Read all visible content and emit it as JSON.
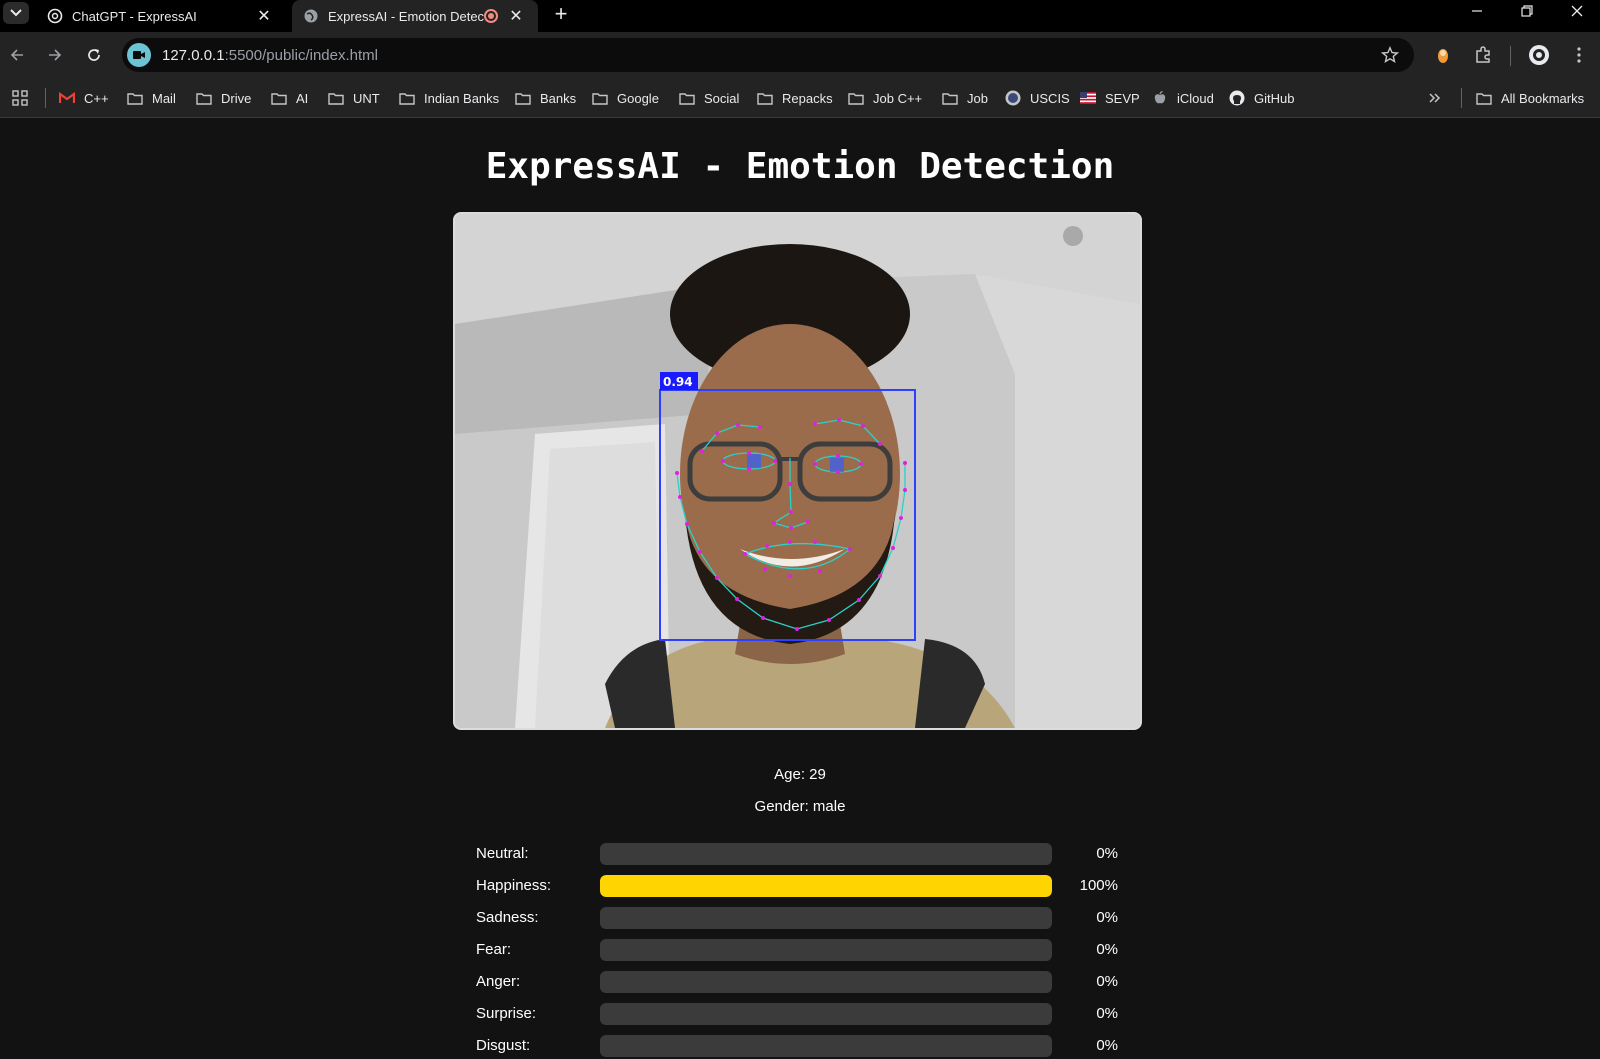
{
  "browser": {
    "tabs": [
      {
        "title": "ChatGPT - ExpressAI",
        "active": false
      },
      {
        "title": "ExpressAI - Emotion Detecti",
        "active": true
      }
    ],
    "url_host": "127.0.0.1",
    "url_rest": ":5500/public/index.html",
    "bookmarks": [
      {
        "label": "C++",
        "icon": "gmail-icon"
      },
      {
        "label": "Mail",
        "icon": "folder-icon"
      },
      {
        "label": "Drive",
        "icon": "folder-icon"
      },
      {
        "label": "AI",
        "icon": "folder-icon"
      },
      {
        "label": "UNT",
        "icon": "folder-icon"
      },
      {
        "label": "Indian Banks",
        "icon": "folder-icon"
      },
      {
        "label": "Banks",
        "icon": "folder-icon"
      },
      {
        "label": "Google",
        "icon": "folder-icon"
      },
      {
        "label": "Social",
        "icon": "folder-icon"
      },
      {
        "label": "Repacks",
        "icon": "folder-icon"
      },
      {
        "label": "Job C++",
        "icon": "folder-icon"
      },
      {
        "label": "Job",
        "icon": "folder-icon"
      },
      {
        "label": "USCIS",
        "icon": "uscis-seal-icon"
      },
      {
        "label": "SEVP",
        "icon": "us-flag-icon"
      },
      {
        "label": "iCloud",
        "icon": "apple-icon"
      },
      {
        "label": "GitHub",
        "icon": "github-icon"
      }
    ],
    "all_bookmarks_label": "All Bookmarks"
  },
  "page": {
    "title": "ExpressAI - Emotion Detection",
    "detection_score": "0.94",
    "age_text": "Age: 29",
    "gender_text": "Gender: male"
  },
  "emotions": [
    {
      "label": "Neutral:",
      "percent_text": "0%",
      "value": 0
    },
    {
      "label": "Happiness:",
      "percent_text": "100%",
      "value": 1.0
    },
    {
      "label": "Sadness:",
      "percent_text": "0%",
      "value": 0
    },
    {
      "label": "Fear:",
      "percent_text": "0%",
      "value": 0
    },
    {
      "label": "Anger:",
      "percent_text": "0%",
      "value": 0
    },
    {
      "label": "Surprise:",
      "percent_text": "0%",
      "value": 0
    },
    {
      "label": "Disgust:",
      "percent_text": "0%",
      "value": 0
    }
  ],
  "colors": {
    "bar_fill": "#ffd400",
    "bar_track": "#3b3b3b",
    "detection_box": "#2f3fff",
    "landmark_line": "#2ad1c8",
    "landmark_point": "#e020e0"
  }
}
